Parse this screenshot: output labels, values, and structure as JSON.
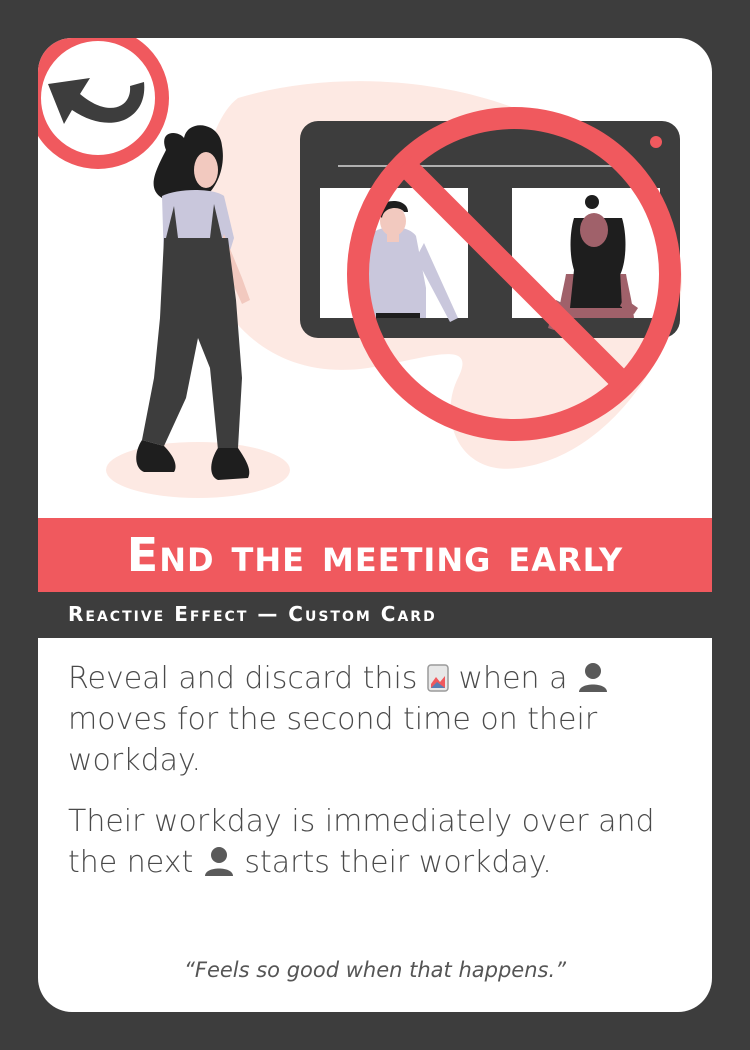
{
  "card": {
    "title": "End the meeting early",
    "type_line": "Reactive Effect — Custom Card",
    "paragraph1": {
      "part1": "Reveal and discard this",
      "part2": "when a",
      "part3": "moves for the second time on their workday."
    },
    "paragraph2": {
      "part1": "Their workday is immediately over and the next",
      "part2": "starts their workday."
    },
    "flavor": "“Feels so good when that happens.”"
  },
  "icons": {
    "return": "return-arrow-icon",
    "card": "card-icon",
    "person": "person-icon",
    "prohibition": "prohibition-icon"
  },
  "colors": {
    "frame": "#3d3d3d",
    "accent": "#f0595e",
    "blob": "#fde9e3",
    "text": "#4a4a4a"
  }
}
